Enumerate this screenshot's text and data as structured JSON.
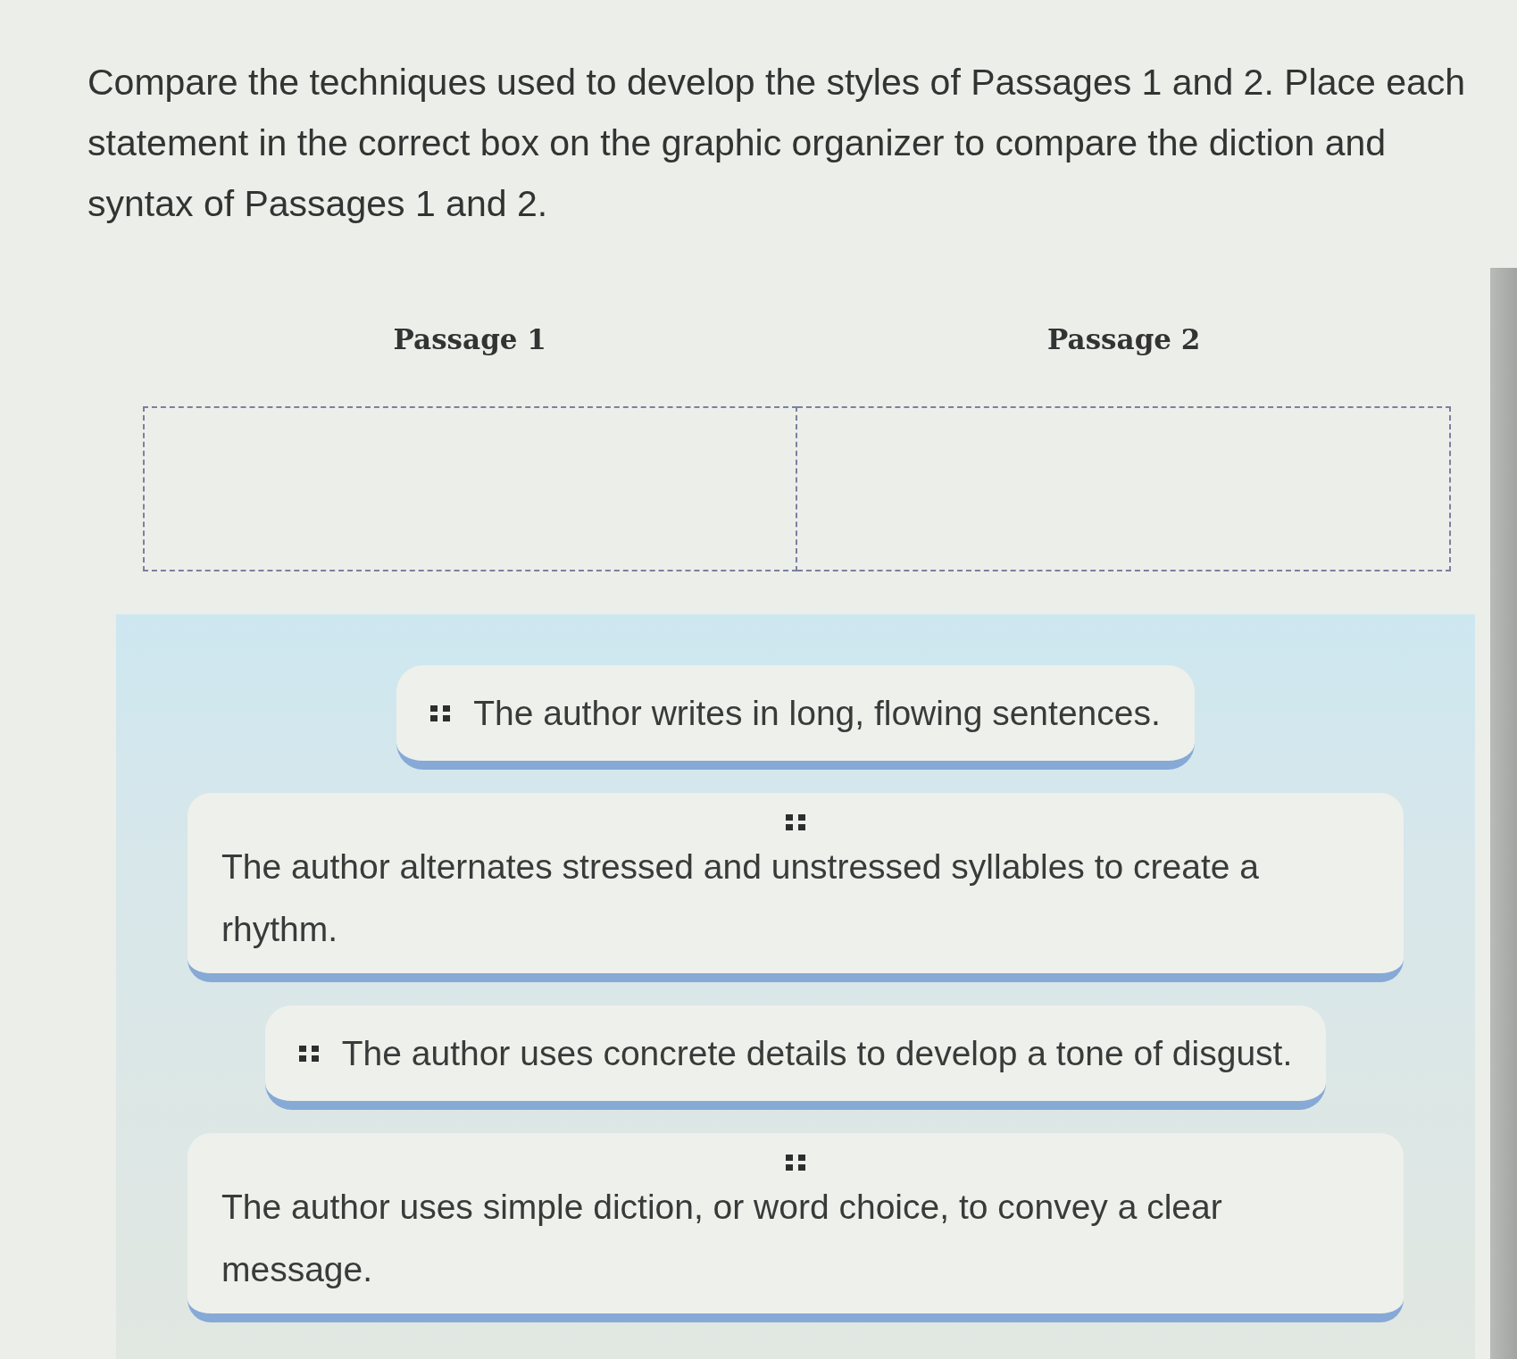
{
  "instructions": "Compare the techniques used to develop the styles of Passages 1 and 2. Place each statement in the correct box on the graphic organizer to compare the diction and syntax of Passages 1 and 2.",
  "organizer": {
    "columns": [
      {
        "heading": "Passage 1"
      },
      {
        "heading": "Passage 2"
      }
    ]
  },
  "statements": [
    {
      "text": "The author writes in long, flowing sentences.",
      "kind": "inline"
    },
    {
      "text": "The author alternates stressed and unstressed syllables to create a rhythm.",
      "kind": "stacked"
    },
    {
      "text": "The author uses concrete details to develop a tone of disgust.",
      "kind": "inline"
    },
    {
      "text": "The author uses simple diction, or word choice, to convey a clear message.",
      "kind": "stacked"
    }
  ]
}
